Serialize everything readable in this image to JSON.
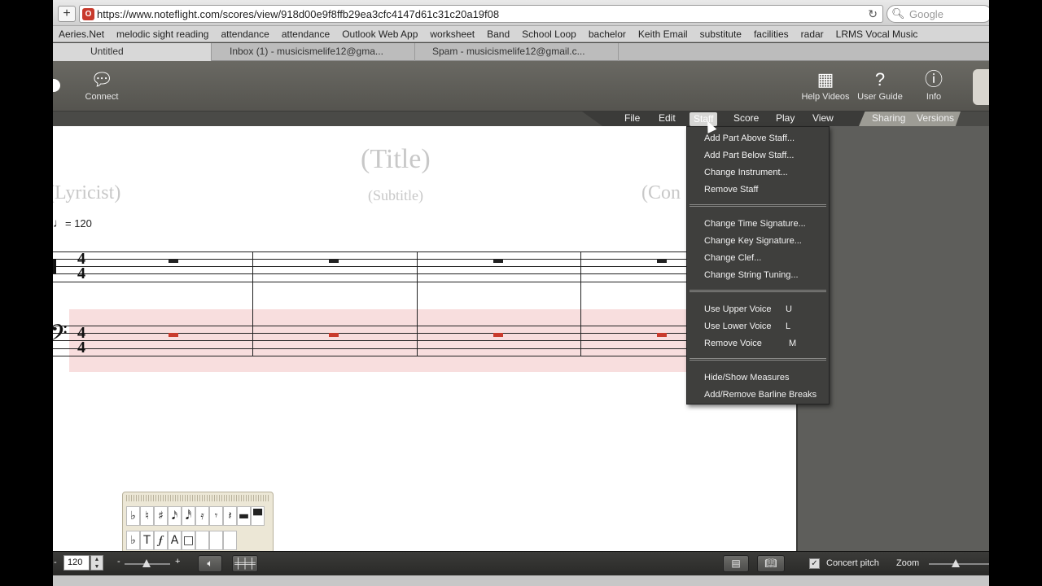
{
  "browser": {
    "url": "https://www.noteflight.com/scores/view/918d00e9f8ffb29ea3cfc4147d61c31c20a19f08",
    "search_placeholder": "Google",
    "bookmarks": [
      "Aeries.Net",
      "melodic sight reading",
      "attendance",
      "attendance",
      "Outlook Web App",
      "worksheet",
      "Band",
      "School Loop",
      "bachelor",
      "Keith Email",
      "substitute",
      "facilities",
      "radar",
      "LRMS Vocal Music"
    ],
    "tabs": [
      "Untitled",
      "Inbox (1) - musicismelife12@gma...",
      "Spam - musicismelife12@gmail.c..."
    ]
  },
  "toolbar": {
    "connect": "Connect",
    "help_videos": "Help Videos",
    "user_guide": "User Guide",
    "info": "Info"
  },
  "menu": {
    "file": "File",
    "edit": "Edit",
    "staff": "Staff",
    "score": "Score",
    "play": "Play",
    "view": "View",
    "sharing": "Sharing",
    "versions": "Versions"
  },
  "score": {
    "title": "(Title)",
    "subtitle": "(Subtitle)",
    "lyricist": "(Lyricist)",
    "composer": "(Con",
    "tempo": "= 120",
    "time_top": "4",
    "time_bottom": "4"
  },
  "staff_menu": {
    "items": [
      {
        "label": "Add Part Above Staff..."
      },
      {
        "label": "Add Part Below Staff..."
      },
      {
        "label": "Change Instrument..."
      },
      {
        "label": "Remove Staff"
      },
      {
        "label": "Change Time Signature..."
      },
      {
        "label": "Change Key Signature..."
      },
      {
        "label": "Change Clef..."
      },
      {
        "label": "Change String Tuning..."
      },
      {
        "label": "Use Upper Voice",
        "key": "U"
      },
      {
        "label": "Use Lower Voice",
        "key": "L"
      },
      {
        "label": "Remove Voice",
        "key": "M"
      },
      {
        "label": "Hide/Show Measures"
      },
      {
        "label": "Add/Remove Barline Breaks"
      }
    ]
  },
  "palette": {
    "row1": [
      "♭",
      "♮",
      "♯",
      "𝅘𝅥𝅯",
      "𝅘𝅥𝅰",
      "𝄿",
      "𝄾",
      "𝄽",
      "▬",
      "▀"
    ],
    "row2": [
      "♭",
      "T",
      "𝆑",
      "A",
      "□",
      "",
      "",
      ""
    ]
  },
  "bottom": {
    "tempo_value": "120",
    "minus": "-",
    "plus": "+",
    "concert_pitch": "Concert pitch",
    "zoom": "Zoom"
  }
}
